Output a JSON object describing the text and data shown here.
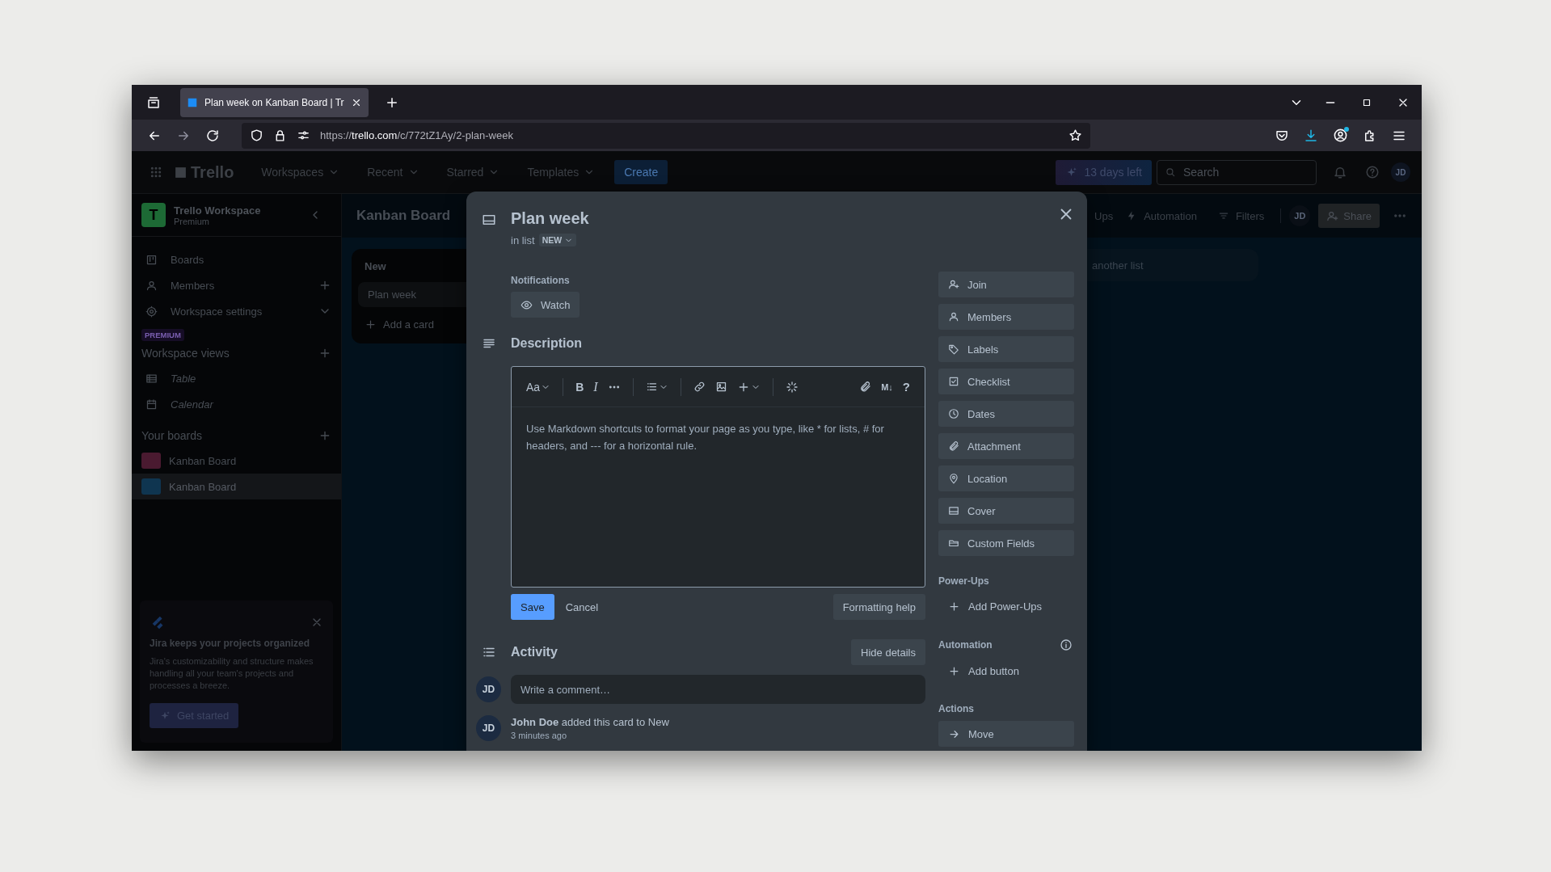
{
  "browser": {
    "tab": {
      "title": "Plan week on Kanban Board | Tr"
    },
    "url": {
      "scheme": "https://",
      "host": "trello.com",
      "path": "/c/772tZ1Ay/2-plan-week"
    }
  },
  "header": {
    "brand": "Trello",
    "menus": [
      "Workspaces",
      "Recent",
      "Starred",
      "Templates"
    ],
    "create": "Create",
    "trial": "13 days left",
    "search": {
      "placeholder": "Search"
    },
    "avatar": "JD"
  },
  "sidebar": {
    "workspace": {
      "initial": "T",
      "name": "Trello Workspace",
      "plan": "Premium"
    },
    "items": [
      {
        "label": "Boards"
      },
      {
        "label": "Members"
      },
      {
        "label": "Workspace settings"
      }
    ],
    "premium_badge": "PREMIUM",
    "views": {
      "title": "Workspace views",
      "items": [
        "Table",
        "Calendar"
      ]
    },
    "boards": {
      "title": "Your boards",
      "items": [
        {
          "name": "Kanban Board",
          "color": "#4a1a30",
          "selected": false
        },
        {
          "name": "Kanban Board",
          "color": "#0f3550",
          "selected": true
        }
      ]
    },
    "promo": {
      "title": "Jira keeps your projects organized",
      "text": "Jira's customizability and structure makes handling all your team's projects and processes a breeze.",
      "button": "Get started"
    }
  },
  "board": {
    "title": "Kanban Board",
    "toolbar": [
      "Ups",
      "Automation",
      "Filters"
    ],
    "avatar": "JD",
    "share": "Share",
    "lists": [
      {
        "title": "New",
        "cards": [
          "Plan week"
        ],
        "add": "Add a card"
      }
    ],
    "add_list": "another list"
  },
  "card_modal": {
    "title": "Plan week",
    "list_prefix": "in list",
    "list_name": "NEW",
    "notifications": {
      "label": "Notifications",
      "button": "Watch"
    },
    "description": {
      "title": "Description",
      "toolbar": {
        "text_style": "Aa",
        "bold": "B",
        "italic": "I",
        "markdown": "M↓",
        "help": "?"
      },
      "placeholder": "Use Markdown shortcuts to format your page as you type, like * for lists, # for headers, and --- for a horizontal rule.",
      "save": "Save",
      "cancel": "Cancel",
      "help": "Formatting help"
    },
    "activity": {
      "title": "Activity",
      "toggle": "Hide details",
      "comment": {
        "avatar": "JD",
        "placeholder": "Write a comment…"
      },
      "entries": [
        {
          "avatar": "JD",
          "text": "**John Doe** added this card to New",
          "time": "3 minutes ago"
        }
      ]
    },
    "actions": [
      "Join",
      "Members",
      "Labels",
      "Checklist",
      "Dates",
      "Attachment",
      "Location",
      "Cover",
      "Custom Fields"
    ],
    "power_ups": {
      "title": "Power-Ups",
      "add": "Add Power-Ups"
    },
    "automation": {
      "title": "Automation",
      "add": "Add button"
    },
    "card_actions": {
      "title": "Actions",
      "items": [
        "Move"
      ]
    }
  }
}
